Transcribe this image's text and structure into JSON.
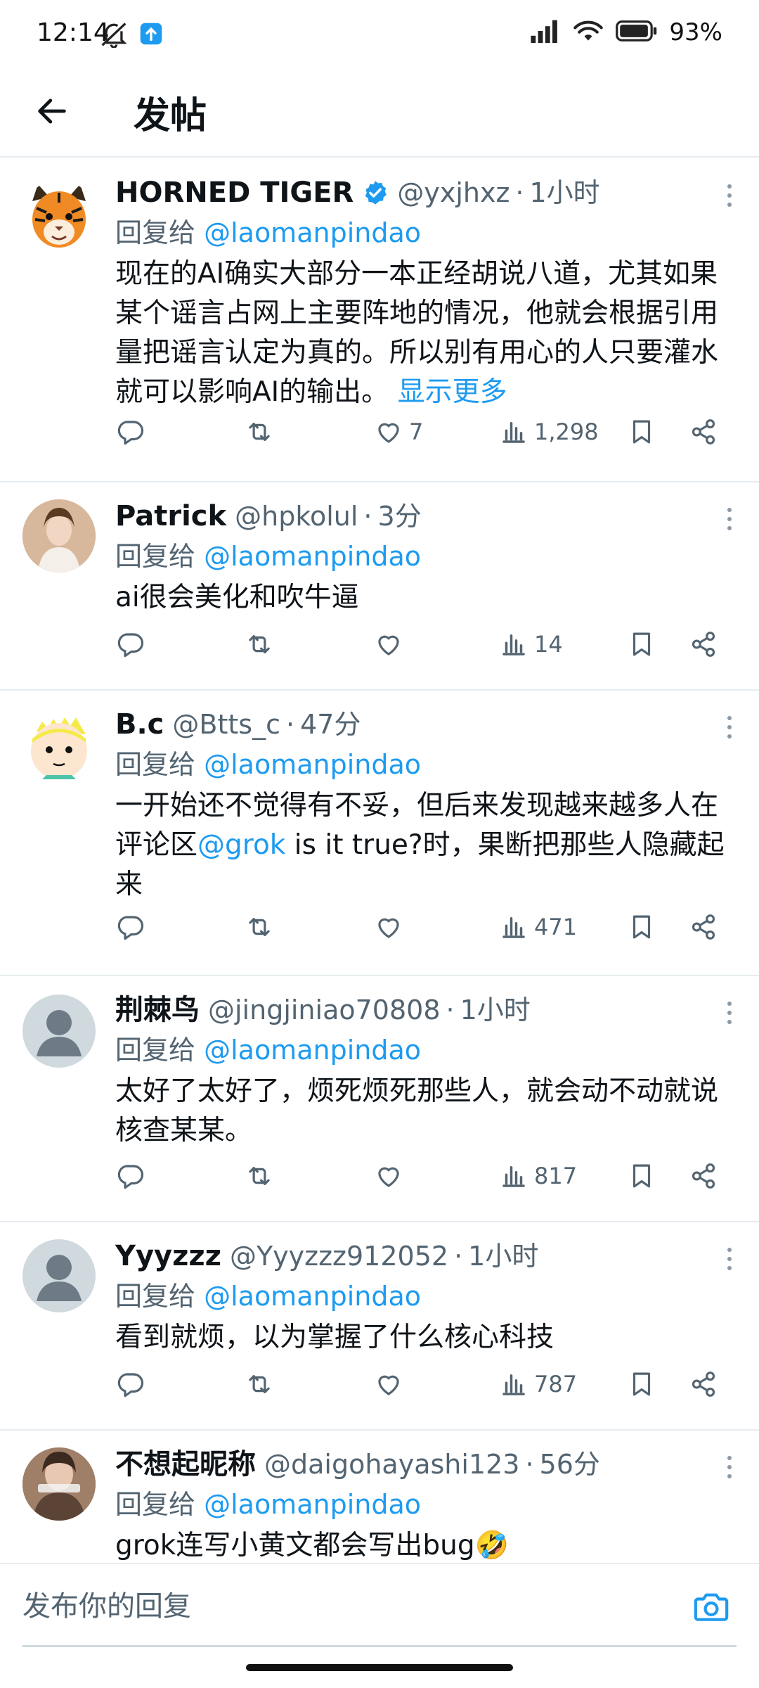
{
  "status_bar": {
    "time": "12:14",
    "battery": "93%",
    "icons": [
      "mute-icon",
      "upload-notification-icon",
      "signal-icon",
      "wifi-icon",
      "battery-icon"
    ]
  },
  "header": {
    "title": "发帖",
    "back_icon": "arrow-left-icon"
  },
  "colors": {
    "accent": "#1d9bf0",
    "text": "#0f1419",
    "muted": "#536471",
    "divider": "#e6ecf0"
  },
  "posts": [
    {
      "name": "HORNED TIGER",
      "verified": true,
      "handle": "@yxjhxz",
      "dot": "·",
      "time": "1小时",
      "reply_prefix": "回复给 ",
      "reply_to": "@laomanpindao",
      "text": "现在的AI确实大部分一本正经胡说八道，尤其如果某个谣言占网上主要阵地的情况，他就会根据引用量把谣言认定为真的。所以别有用心的人只要灌水就可以影响AI的输出。",
      "show_more": "显示更多",
      "likes": "7",
      "views": "1,298"
    },
    {
      "name": "Patrick",
      "handle": "@hpkolul",
      "dot": "·",
      "time": "3分",
      "reply_prefix": "回复给 ",
      "reply_to": "@laomanpindao",
      "text": "ai很会美化和吹牛逼",
      "likes": "",
      "views": "14"
    },
    {
      "name": "B.c",
      "handle": "@Btts_c",
      "dot": "·",
      "time": "47分",
      "reply_prefix": "回复给 ",
      "reply_to": "@laomanpindao",
      "text_before": "一开始还不觉得有不妥，但后来发现越来越多人在评论区",
      "text_link": "@grok",
      "text_after": " is it true?时，果断把那些人隐藏起来",
      "likes": "",
      "views": "471"
    },
    {
      "name": "荆棘鸟",
      "handle": "@jingjiniao70808",
      "dot": "·",
      "time": "1小时",
      "reply_prefix": "回复给 ",
      "reply_to": "@laomanpindao",
      "text": "太好了太好了，烦死烦死那些人，就会动不动就说核查某某。",
      "likes": "",
      "views": "817"
    },
    {
      "name": "Yyyzzz",
      "handle": "@Yyyzzz912052",
      "dot": "·",
      "time": "1小时",
      "reply_prefix": "回复给 ",
      "reply_to": "@laomanpindao",
      "text": "看到就烦，以为掌握了什么核心科技",
      "likes": "",
      "views": "787"
    },
    {
      "name": "不想起昵称",
      "handle": "@daigohayashi123",
      "dot": "·",
      "time": "56分",
      "reply_prefix": "回复给 ",
      "reply_to": "@laomanpindao",
      "text": "grok连写小黄文都会写出bug🤣"
    }
  ],
  "reply_bar": {
    "placeholder": "发布你的回复",
    "camera_icon": "camera-icon"
  }
}
